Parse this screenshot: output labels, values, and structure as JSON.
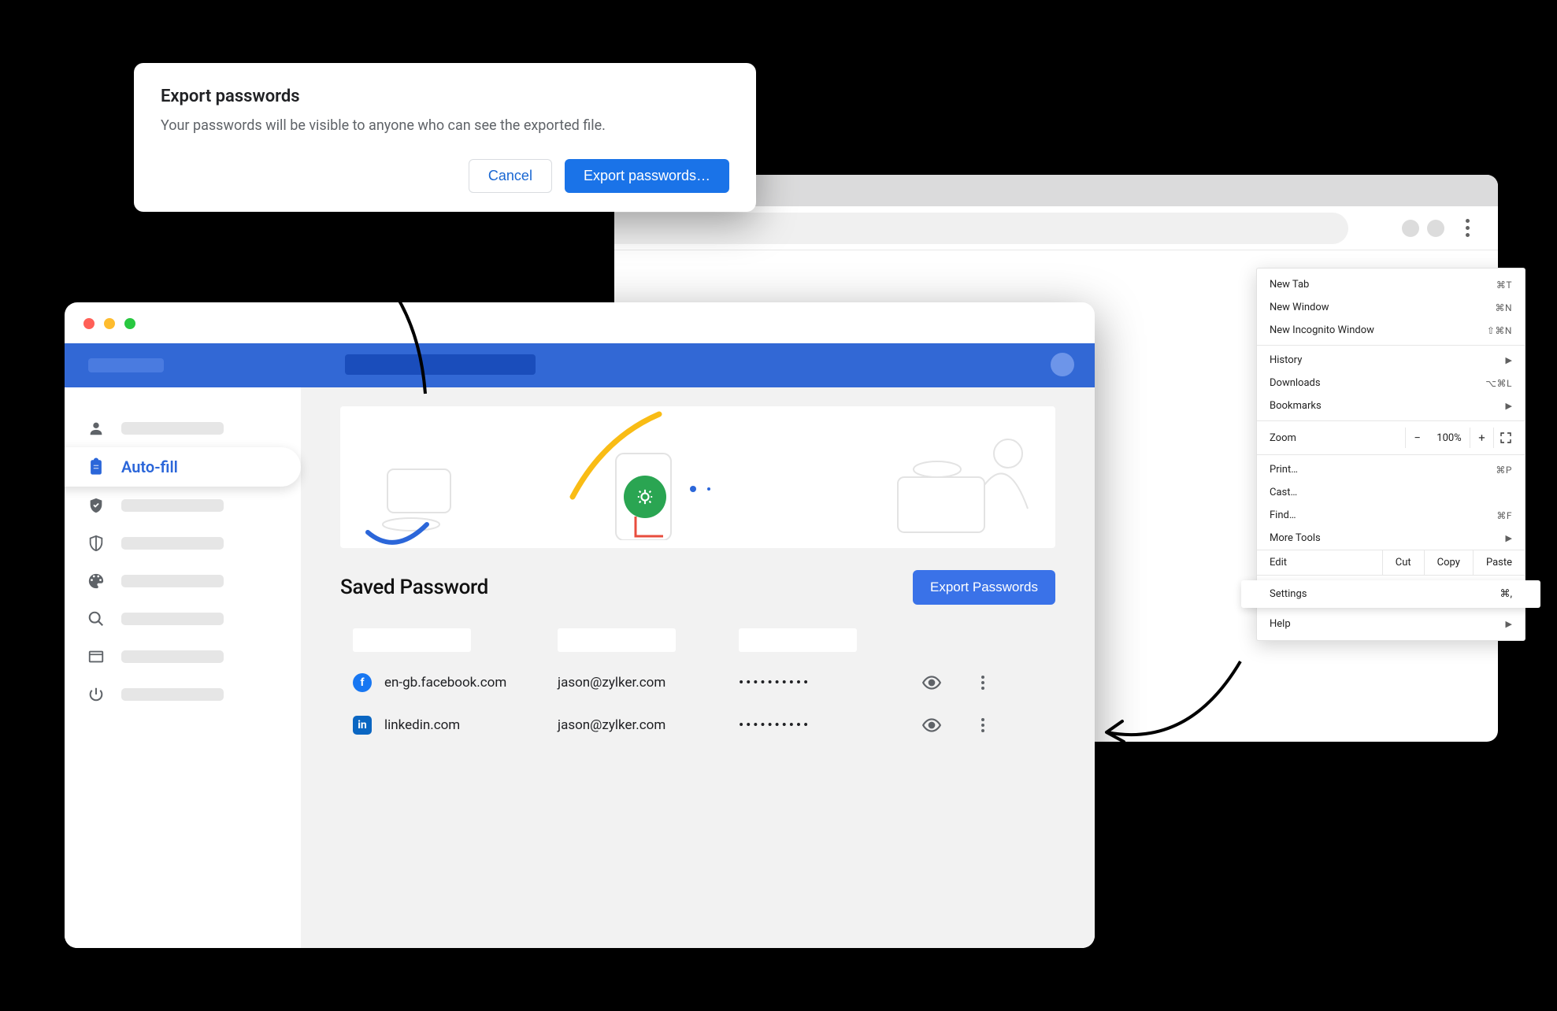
{
  "dialog": {
    "title": "Export passwords",
    "body": "Your passwords will be visible to anyone who can see the exported file.",
    "cancel": "Cancel",
    "confirm": "Export passwords…"
  },
  "sidebar": {
    "active_label": "Auto-fill"
  },
  "main": {
    "section_title": "Saved Password",
    "export_button": "Export Passwords",
    "rows": [
      {
        "icon": "facebook",
        "site": "en-gb.facebook.com",
        "user": "jason@zylker.com",
        "password_mask": "••••••••••"
      },
      {
        "icon": "linkedin",
        "site": "linkedin.com",
        "user": "jason@zylker.com",
        "password_mask": "••••••••••"
      }
    ]
  },
  "chrome_menu": {
    "new_tab": {
      "label": "New Tab",
      "shortcut": "⌘T"
    },
    "new_window": {
      "label": "New Window",
      "shortcut": "⌘N"
    },
    "incognito": {
      "label": "New Incognito Window",
      "shortcut": "⇧⌘N"
    },
    "history": {
      "label": "History"
    },
    "downloads": {
      "label": "Downloads",
      "shortcut": "⌥⌘L"
    },
    "bookmarks": {
      "label": "Bookmarks"
    },
    "zoom_label": "Zoom",
    "zoom_pct": "100%",
    "print": {
      "label": "Print…",
      "shortcut": "⌘P"
    },
    "cast": {
      "label": "Cast…"
    },
    "find": {
      "label": "Find…",
      "shortcut": "⌘F"
    },
    "more_tools": {
      "label": "More Tools"
    },
    "edit_label": "Edit",
    "cut": "Cut",
    "copy": "Copy",
    "paste": "Paste",
    "settings": {
      "label": "Settings",
      "shortcut": "⌘,"
    },
    "help": {
      "label": "Help"
    }
  }
}
